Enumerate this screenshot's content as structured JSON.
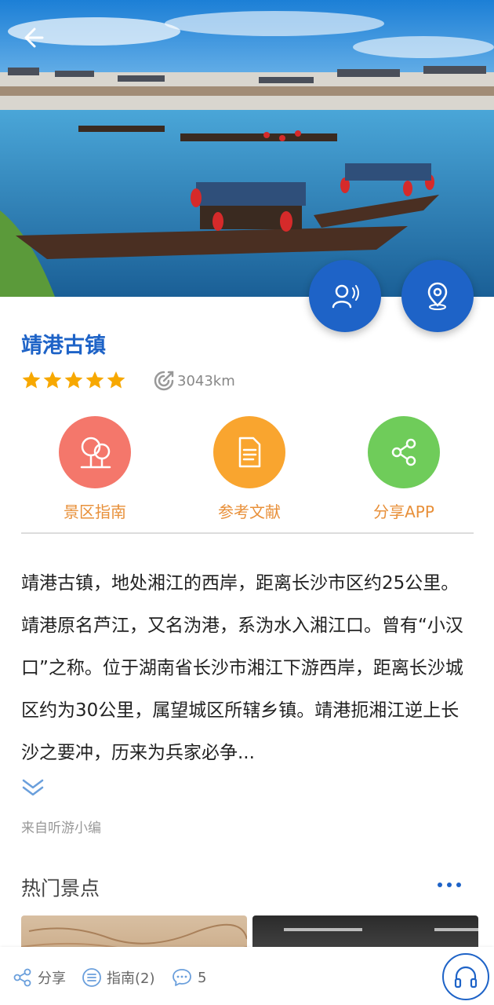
{
  "spot": {
    "name": "靖港古镇",
    "rating": 5,
    "distance": "3043km"
  },
  "actions": [
    {
      "label": "景区指南",
      "icon": "tree-icon"
    },
    {
      "label": "参考文献",
      "icon": "document-icon"
    },
    {
      "label": "分享APP",
      "icon": "share-icon"
    }
  ],
  "description": "靖港古镇，地处湘江的西岸，距离长沙市区约25公里。靖港原名芦江，又名沩港，系沩水入湘江口。曾有“小汉口”之称。位于湖南省长沙市湘江下游西岸，距离长沙城区约为30公里，属望城区所辖乡镇。靖港扼湘江逆上长沙之要冲，历来为兵家必争...",
  "source": "来自听游小编",
  "hot_spots": {
    "title": "热门景点"
  },
  "bottom_bar": {
    "share_label": "分享",
    "guide_label": "指南(2)",
    "comment_count": "5"
  },
  "colors": {
    "primary": "#1e63c7",
    "star": "#f7a800",
    "label_orange": "#e8903a"
  }
}
